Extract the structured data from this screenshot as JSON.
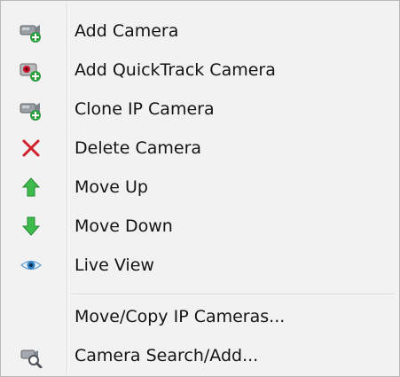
{
  "menu": {
    "items": [
      {
        "label": "Add Camera",
        "icon": "add-camera-icon"
      },
      {
        "label": "Add QuickTrack Camera",
        "icon": "add-quicktrack-camera-icon"
      },
      {
        "label": "Clone IP Camera",
        "icon": "clone-ip-camera-icon"
      },
      {
        "label": "Delete Camera",
        "icon": "delete-x-icon",
        "icon_color": "#d0202a"
      },
      {
        "label": "Move Up",
        "icon": "arrow-up-icon",
        "icon_color": "#39b54a"
      },
      {
        "label": "Move Down",
        "icon": "arrow-down-icon",
        "icon_color": "#39b54a"
      },
      {
        "label": "Live View",
        "icon": "eye-icon"
      },
      {
        "label": "Move/Copy IP Cameras...",
        "icon": ""
      },
      {
        "label": "Camera Search/Add...",
        "icon": "camera-search-icon"
      }
    ]
  }
}
